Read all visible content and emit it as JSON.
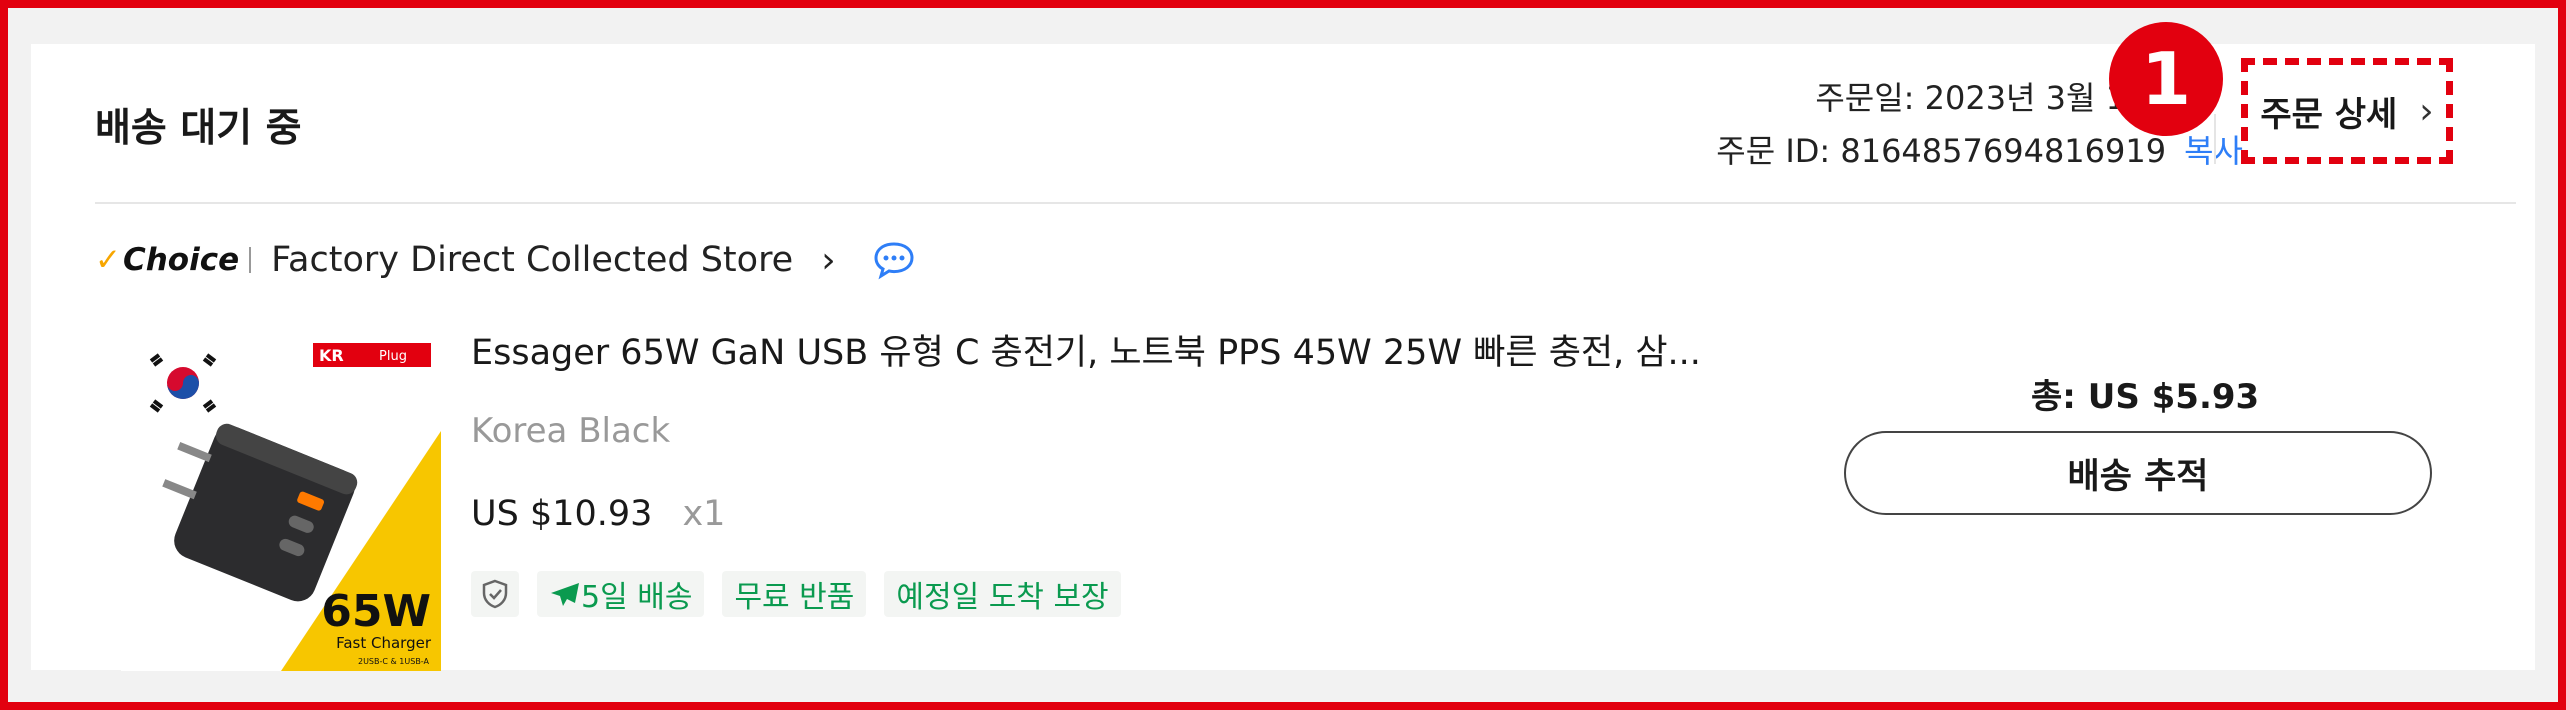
{
  "order": {
    "status": "배송 대기 중",
    "order_date": "주문일: 2023년 3월 1",
    "order_id_text": "주문 ID: 8164857694816919",
    "copy_label": "복사",
    "detail_label": "주문 상세",
    "detail_chevron": "›",
    "step_badge": "1"
  },
  "store": {
    "badge_check": "✓",
    "badge_text": "Choice",
    "name": "Factory Direct Collected Store",
    "chevron": "›",
    "chat_icon": "chat-bubble-icon"
  },
  "product": {
    "title": "Essager 65W GaN USB 유형 C 충전기, 노트북 PPS 45W 25W 빠른 충전, 삼...",
    "variant": "Korea Black",
    "price": "US $10.93",
    "quantity": "x1",
    "image": {
      "plug_label": "KR",
      "plug_sub": "Plug",
      "watt": "65W",
      "subtitle": "Fast Charger",
      "small_text": "2USB-C & 1USB-A"
    },
    "tags": {
      "shield_icon": "shield-check-icon",
      "plane_icon": "plane-icon",
      "delivery": "5일 배송",
      "free_return": "무료 반품",
      "guarantee": "예정일 도착 보장"
    }
  },
  "summary": {
    "total_label": "총: ",
    "total_value": "US $5.93",
    "track_label": "배송 추적"
  },
  "colors": {
    "highlight_red": "#e2000f",
    "link_blue": "#2e7ef7",
    "tag_green": "#0a9a4f",
    "choice_yellow": "#f7a600"
  }
}
